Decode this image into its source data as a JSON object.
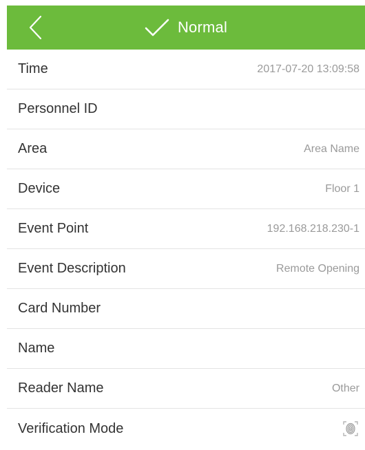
{
  "header": {
    "title": "Normal",
    "back_icon": "chevron-left-icon",
    "status_icon": "check-icon",
    "background_color": "#6cbb3c"
  },
  "details": {
    "time": {
      "label": "Time",
      "value": "2017-07-20 13:09:58"
    },
    "personnel_id": {
      "label": "Personnel ID",
      "value": ""
    },
    "area": {
      "label": "Area",
      "value": "Area Name"
    },
    "device": {
      "label": "Device",
      "value": "Floor 1"
    },
    "event_point": {
      "label": "Event Point",
      "value": "192.168.218.230-1"
    },
    "event_description": {
      "label": "Event Description",
      "value": "Remote Opening"
    },
    "card_number": {
      "label": "Card Number",
      "value": ""
    },
    "name": {
      "label": "Name",
      "value": ""
    },
    "reader_name": {
      "label": "Reader Name",
      "value": "Other"
    },
    "verification_mode": {
      "label": "Verification Mode",
      "icon": "fingerprint-icon"
    }
  }
}
